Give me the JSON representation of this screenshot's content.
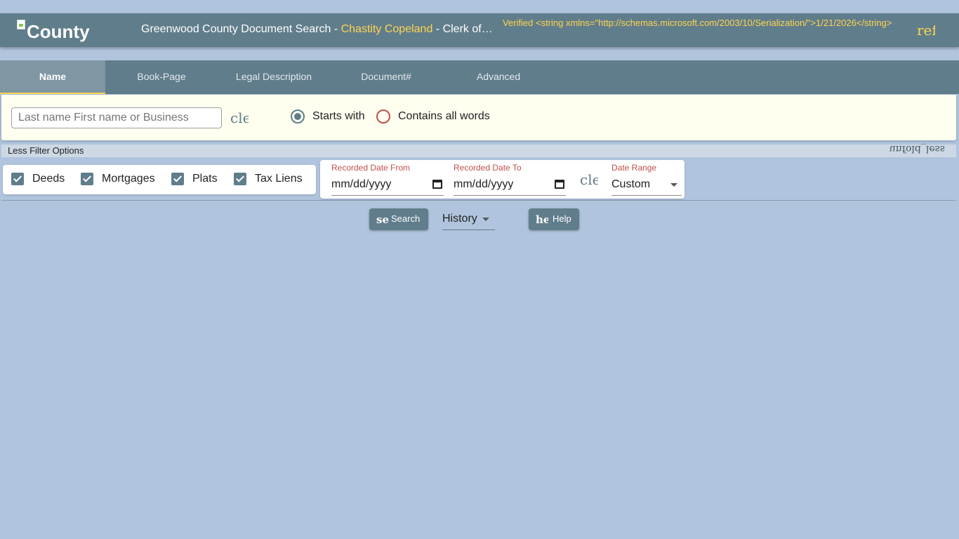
{
  "header": {
    "logo_alt": "County",
    "title_prefix": "Greenwood County Document Search - ",
    "clerk_name": "Chastity Copeland",
    "title_suffix": " - Clerk of Court",
    "verified_text": "Verified <string xmlns=\"http://schemas.microsoft.com/2003/10/Serialization/\">1/21/2026</string>",
    "refresh_icon_text": "refresh"
  },
  "tabs": [
    {
      "label": "Name",
      "active": true
    },
    {
      "label": "Book-Page",
      "active": false
    },
    {
      "label": "Legal Description",
      "active": false
    },
    {
      "label": "Document#",
      "active": false
    },
    {
      "label": "Advanced",
      "active": false
    }
  ],
  "search": {
    "placeholder": "Last name First name or Business",
    "value": "",
    "clear_icon_text": "clear",
    "match_options": [
      {
        "label": "Starts with",
        "selected": true
      },
      {
        "label": "Contains all words",
        "selected": false
      }
    ]
  },
  "filters": {
    "toggle_label": "Less Filter Options",
    "collapse_icon_text": "unfold_less",
    "doc_types": [
      {
        "label": "Deeds",
        "checked": true
      },
      {
        "label": "Mortgages",
        "checked": true
      },
      {
        "label": "Plats",
        "checked": true
      },
      {
        "label": "Tax Liens",
        "checked": true
      }
    ],
    "date_from_label": "Recorded Date From",
    "date_from_value": "mm/dd/yyyy",
    "date_to_label": "Recorded Date To",
    "date_to_value": "mm/dd/yyyy",
    "clear_dates_icon_text": "clear",
    "date_range_label": "Date Range",
    "date_range_value": "Custom"
  },
  "actions": {
    "search_icon_text": "search",
    "search_label": "Search",
    "history_label": "History",
    "help_icon_text": "help",
    "help_label": "Help"
  },
  "colors": {
    "page_bg": "#b0c4de",
    "primary": "#607d8b",
    "accent_yellow": "#ffd54f",
    "panel_bg": "#fffff0",
    "date_label_red": "#c0504d"
  }
}
